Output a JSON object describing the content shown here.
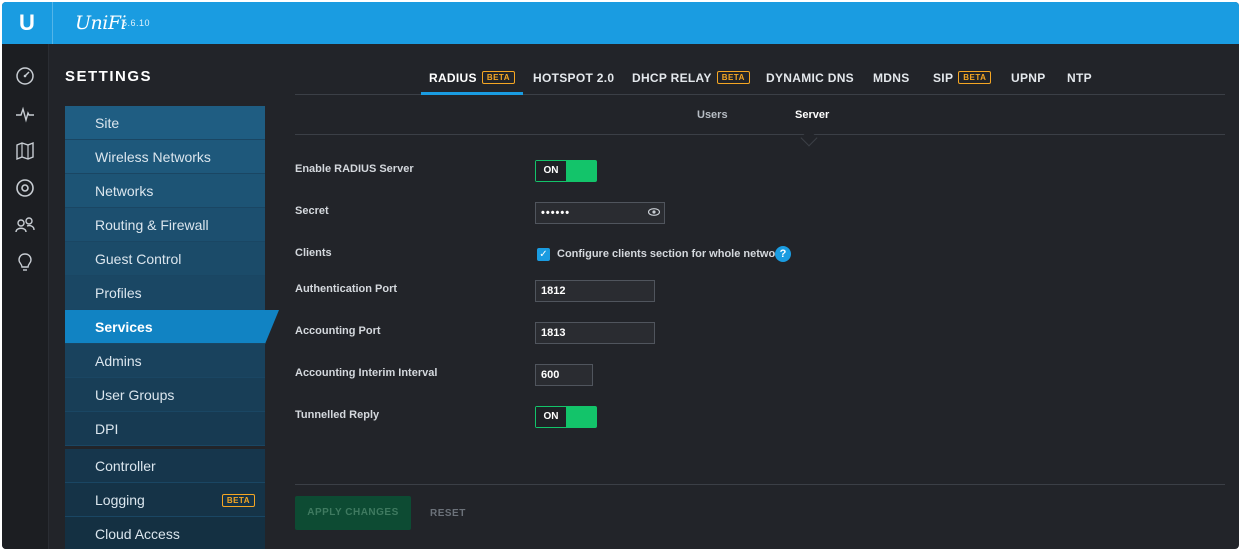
{
  "header": {
    "brand": "UniFi",
    "version": "5.6.10"
  },
  "rail": {
    "icons": [
      "dashboard-icon",
      "statistics-icon",
      "map-icon",
      "devices-icon",
      "clients-icon",
      "insights-icon"
    ]
  },
  "settings": {
    "title": "SETTINGS",
    "nav": [
      {
        "label": "Site"
      },
      {
        "label": "Wireless Networks"
      },
      {
        "label": "Networks"
      },
      {
        "label": "Routing & Firewall"
      },
      {
        "label": "Guest Control"
      },
      {
        "label": "Profiles"
      },
      {
        "label": "Services",
        "active": true
      },
      {
        "label": "Admins"
      },
      {
        "label": "User Groups"
      },
      {
        "label": "DPI"
      }
    ],
    "nav2": [
      {
        "label": "Controller"
      },
      {
        "label": "Logging",
        "badge": "BETA"
      },
      {
        "label": "Cloud Access"
      }
    ]
  },
  "tabs": [
    {
      "label": "RADIUS",
      "badge": "BETA",
      "active": true
    },
    {
      "label": "HOTSPOT 2.0"
    },
    {
      "label": "DHCP RELAY",
      "badge": "BETA"
    },
    {
      "label": "DYNAMIC DNS"
    },
    {
      "label": "MDNS"
    },
    {
      "label": "SIP",
      "badge": "BETA"
    },
    {
      "label": "UPNP"
    },
    {
      "label": "NTP"
    }
  ],
  "subtabs": [
    {
      "label": "Users"
    },
    {
      "label": "Server",
      "active": true
    }
  ],
  "form": {
    "enable_label": "Enable RADIUS Server",
    "enable_state": "ON",
    "secret_label": "Secret",
    "secret_value": "••••••",
    "clients_label": "Clients",
    "clients_check": "Configure clients section for whole network",
    "auth_port_label": "Authentication Port",
    "auth_port_value": "1812",
    "acct_port_label": "Accounting Port",
    "acct_port_value": "1813",
    "interim_label": "Accounting Interim Interval",
    "interim_value": "600",
    "tunnelled_label": "Tunnelled Reply",
    "tunnelled_state": "ON"
  },
  "footer": {
    "apply": "APPLY CHANGES",
    "reset": "RESET"
  },
  "colors": {
    "accent": "#1a9ce1",
    "toggle_on": "#13c46a",
    "beta": "#f5a623"
  }
}
